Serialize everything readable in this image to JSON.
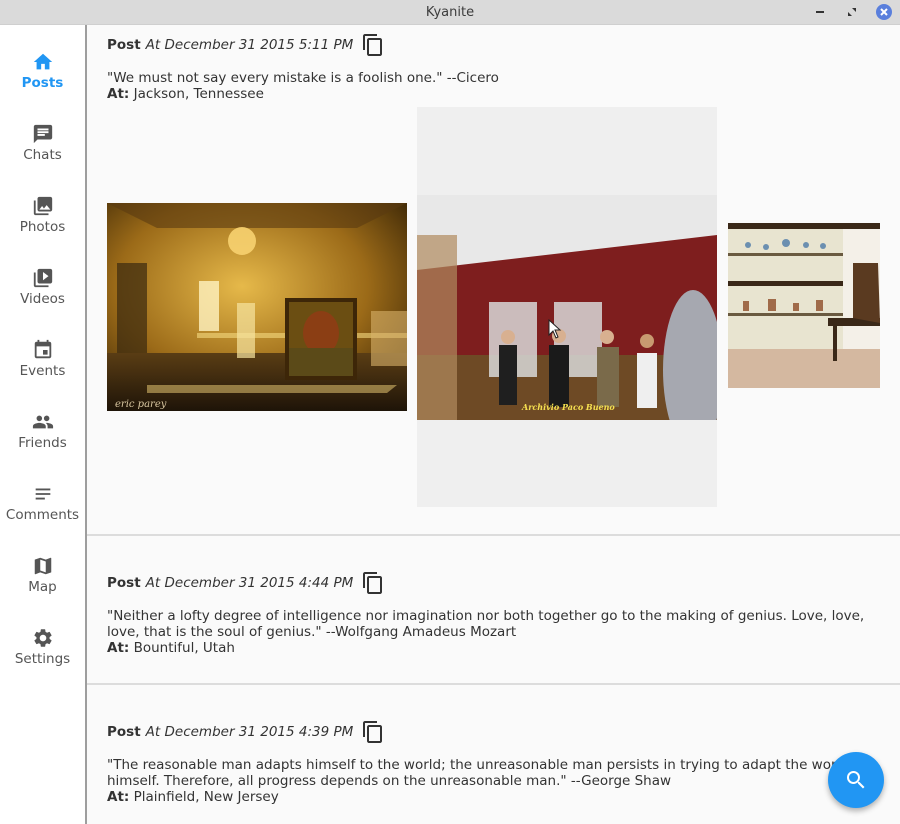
{
  "window": {
    "title": "Kyanite",
    "controls": [
      "minimize",
      "maximize",
      "close"
    ]
  },
  "sidebar": {
    "items": [
      {
        "label": "Posts",
        "icon": "home-icon",
        "active": true
      },
      {
        "label": "Chats",
        "icon": "chat-icon",
        "active": false
      },
      {
        "label": "Photos",
        "icon": "photos-icon",
        "active": false
      },
      {
        "label": "Videos",
        "icon": "videos-icon",
        "active": false
      },
      {
        "label": "Events",
        "icon": "calendar-icon",
        "active": false
      },
      {
        "label": "Friends",
        "icon": "people-icon",
        "active": false
      },
      {
        "label": "Comments",
        "icon": "comments-icon",
        "active": false
      },
      {
        "label": "Map",
        "icon": "map-icon",
        "active": false
      },
      {
        "label": "Settings",
        "icon": "gear-icon",
        "active": false
      }
    ]
  },
  "posts": [
    {
      "kind": "Post",
      "date": "At December 31 2015 5:11 PM",
      "text": "\"We must not say every mistake is a foolish one.\" --Cicero",
      "at_label": "At:",
      "location": "Jackson, Tennessee",
      "images": [
        {
          "description": "Golden-lit room with chandelier and large painting",
          "caption": "eric parey"
        },
        {
          "description": "Group of people in a red-walled gallery behind glass",
          "caption": "Archivio Paco Bueno"
        },
        {
          "description": "Museum display cabinets with glass shelves",
          "caption": ""
        }
      ]
    },
    {
      "kind": "Post",
      "date": "At December 31 2015 4:44 PM",
      "text": "\"Neither a lofty degree of intelligence nor imagination nor both together go to the making of genius. Love, love, love, that is the soul of genius.\" --Wolfgang Amadeus Mozart",
      "at_label": "At:",
      "location": "Bountiful, Utah"
    },
    {
      "kind": "Post",
      "date": "At December 31 2015 4:39 PM",
      "text": "\"The reasonable man adapts himself to the world; the unreasonable man persists in trying to adapt the world to himself. Therefore, all progress depends on the unreasonable man.\" --George Shaw",
      "at_label": "At:",
      "location": "Plainfield, New Jersey"
    }
  ],
  "fab": {
    "icon": "search-icon",
    "label": "Search"
  }
}
